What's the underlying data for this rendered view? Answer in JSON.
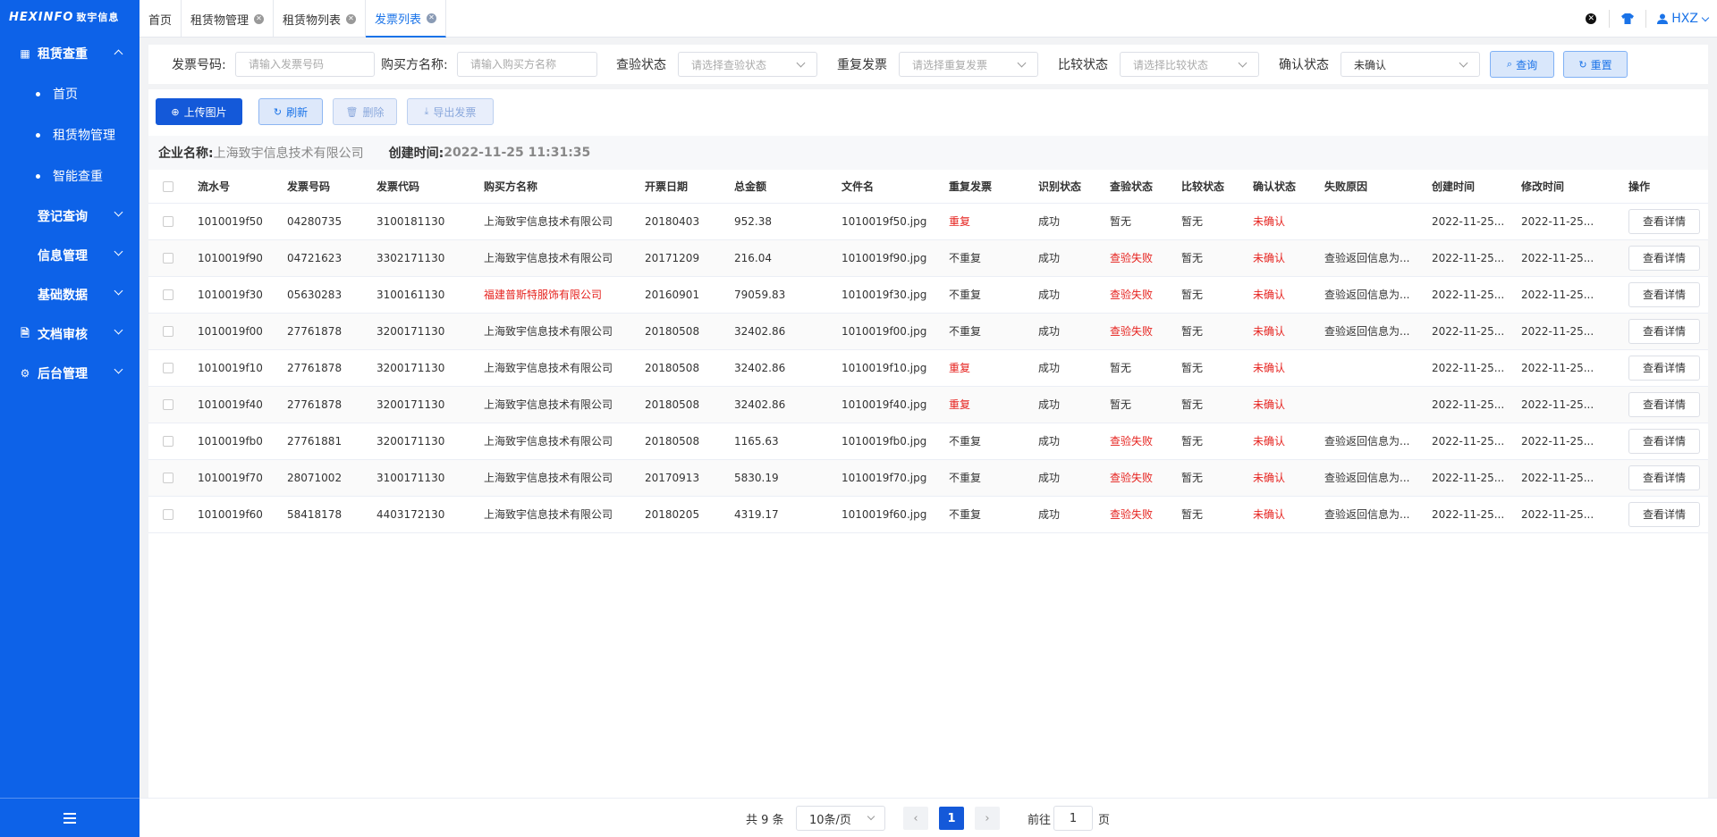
{
  "sidebar": {
    "logo_en": "HEXINFO",
    "logo_cn": "致宇信息",
    "groups": [
      {
        "label": "租赁查重",
        "icon": "grid-icon",
        "expanded": true,
        "children": [
          "首页",
          "租赁物管理",
          "智能查重"
        ]
      },
      {
        "label": "登记查询",
        "icon": "",
        "expanded": false
      },
      {
        "label": "信息管理",
        "icon": "",
        "expanded": false
      },
      {
        "label": "基础数据",
        "icon": "",
        "expanded": false
      },
      {
        "label": "文档审核",
        "icon": "document-icon",
        "expanded": false
      },
      {
        "label": "后台管理",
        "icon": "gear-icon",
        "expanded": false
      }
    ]
  },
  "tabs": [
    {
      "label": "首页",
      "closable": false,
      "active": false
    },
    {
      "label": "租赁物管理",
      "closable": true,
      "active": false
    },
    {
      "label": "租赁物列表",
      "closable": true,
      "active": false
    },
    {
      "label": "发票列表",
      "closable": true,
      "active": true
    }
  ],
  "user": {
    "name": "HXZ"
  },
  "filters": {
    "invoice_no_label": "发票号码:",
    "invoice_no_placeholder": "请输入发票号码",
    "buyer_label": "购买方名称:",
    "buyer_placeholder": "请输入购买方名称",
    "verify_label": "查验状态",
    "verify_placeholder": "请选择查验状态",
    "dup_label": "重复发票",
    "dup_placeholder": "请选择重复发票",
    "compare_label": "比较状态",
    "compare_placeholder": "请选择比较状态",
    "confirm_label": "确认状态",
    "confirm_value": "未确认",
    "query_btn": "查询",
    "reset_btn": "重置"
  },
  "actions": {
    "upload": "上传图片",
    "refresh": "刷新",
    "delete": "删除",
    "export": "导出发票"
  },
  "company": {
    "name_key": "企业名称:",
    "name_value": "上海致宇信息技术有限公司",
    "created_key": "创建时间:",
    "created_value": "2022-11-25 11:31:35"
  },
  "table": {
    "columns": [
      "流水号",
      "发票号码",
      "发票代码",
      "购买方名称",
      "开票日期",
      "总金额",
      "文件名",
      "重复发票",
      "识别状态",
      "查验状态",
      "比较状态",
      "确认状态",
      "失败原因",
      "创建时间",
      "修改时间",
      "操作"
    ],
    "detail_btn": "查看详情",
    "rows": [
      {
        "serial": "1010019f50",
        "inv_no": "04280735",
        "inv_code": "3100181130",
        "buyer": "上海致宇信息技术有限公司",
        "buyer_red": false,
        "date": "20180403",
        "amount": "952.38",
        "file": "1010019f50.jpg",
        "dup": "重复",
        "dup_red": true,
        "recog": "成功",
        "verify": "暂无",
        "verify_red": false,
        "compare": "暂无",
        "confirm": "未确认",
        "reason": "",
        "created": "2022-11-25...",
        "modified": "2022-11-25..."
      },
      {
        "serial": "1010019f90",
        "inv_no": "04721623",
        "inv_code": "3302171130",
        "buyer": "上海致宇信息技术有限公司",
        "buyer_red": false,
        "date": "20171209",
        "amount": "216.04",
        "file": "1010019f90.jpg",
        "dup": "不重复",
        "dup_red": false,
        "recog": "成功",
        "verify": "查验失败",
        "verify_red": true,
        "compare": "暂无",
        "confirm": "未确认",
        "reason": "查验返回信息为...",
        "created": "2022-11-25...",
        "modified": "2022-11-25..."
      },
      {
        "serial": "1010019f30",
        "inv_no": "05630283",
        "inv_code": "3100161130",
        "buyer": "福建普斯特服饰有限公司",
        "buyer_red": true,
        "date": "20160901",
        "amount": "79059.83",
        "file": "1010019f30.jpg",
        "dup": "不重复",
        "dup_red": false,
        "recog": "成功",
        "verify": "查验失败",
        "verify_red": true,
        "compare": "暂无",
        "confirm": "未确认",
        "reason": "查验返回信息为...",
        "created": "2022-11-25...",
        "modified": "2022-11-25..."
      },
      {
        "serial": "1010019f00",
        "inv_no": "27761878",
        "inv_code": "3200171130",
        "buyer": "上海致宇信息技术有限公司",
        "buyer_red": false,
        "date": "20180508",
        "amount": "32402.86",
        "file": "1010019f00.jpg",
        "dup": "不重复",
        "dup_red": false,
        "recog": "成功",
        "verify": "查验失败",
        "verify_red": true,
        "compare": "暂无",
        "confirm": "未确认",
        "reason": "查验返回信息为...",
        "created": "2022-11-25...",
        "modified": "2022-11-25..."
      },
      {
        "serial": "1010019f10",
        "inv_no": "27761878",
        "inv_code": "3200171130",
        "buyer": "上海致宇信息技术有限公司",
        "buyer_red": false,
        "date": "20180508",
        "amount": "32402.86",
        "file": "1010019f10.jpg",
        "dup": "重复",
        "dup_red": true,
        "recog": "成功",
        "verify": "暂无",
        "verify_red": false,
        "compare": "暂无",
        "confirm": "未确认",
        "reason": "",
        "created": "2022-11-25...",
        "modified": "2022-11-25..."
      },
      {
        "serial": "1010019f40",
        "inv_no": "27761878",
        "inv_code": "3200171130",
        "buyer": "上海致宇信息技术有限公司",
        "buyer_red": false,
        "date": "20180508",
        "amount": "32402.86",
        "file": "1010019f40.jpg",
        "dup": "重复",
        "dup_red": true,
        "recog": "成功",
        "verify": "暂无",
        "verify_red": false,
        "compare": "暂无",
        "confirm": "未确认",
        "reason": "",
        "created": "2022-11-25...",
        "modified": "2022-11-25..."
      },
      {
        "serial": "1010019fb0",
        "inv_no": "27761881",
        "inv_code": "3200171130",
        "buyer": "上海致宇信息技术有限公司",
        "buyer_red": false,
        "date": "20180508",
        "amount": "1165.63",
        "file": "1010019fb0.jpg",
        "dup": "不重复",
        "dup_red": false,
        "recog": "成功",
        "verify": "查验失败",
        "verify_red": true,
        "compare": "暂无",
        "confirm": "未确认",
        "reason": "查验返回信息为...",
        "created": "2022-11-25...",
        "modified": "2022-11-25..."
      },
      {
        "serial": "1010019f70",
        "inv_no": "28071002",
        "inv_code": "3100171130",
        "buyer": "上海致宇信息技术有限公司",
        "buyer_red": false,
        "date": "20170913",
        "amount": "5830.19",
        "file": "1010019f70.jpg",
        "dup": "不重复",
        "dup_red": false,
        "recog": "成功",
        "verify": "查验失败",
        "verify_red": true,
        "compare": "暂无",
        "confirm": "未确认",
        "reason": "查验返回信息为...",
        "created": "2022-11-25...",
        "modified": "2022-11-25..."
      },
      {
        "serial": "1010019f60",
        "inv_no": "58418178",
        "inv_code": "4403172130",
        "buyer": "上海致宇信息技术有限公司",
        "buyer_red": false,
        "date": "20180205",
        "amount": "4319.17",
        "file": "1010019f60.jpg",
        "dup": "不重复",
        "dup_red": false,
        "recog": "成功",
        "verify": "查验失败",
        "verify_red": true,
        "compare": "暂无",
        "confirm": "未确认",
        "reason": "查验返回信息为...",
        "created": "2022-11-25...",
        "modified": "2022-11-25..."
      }
    ]
  },
  "pagination": {
    "total": "共 9 条",
    "page_size": "10条/页",
    "current": "1",
    "goto_label": "前往",
    "goto_value": "1",
    "page_unit": "页"
  },
  "colors": {
    "sidebar": "#0d62e8",
    "primary": "#1459d9",
    "danger": "#e6231f"
  }
}
